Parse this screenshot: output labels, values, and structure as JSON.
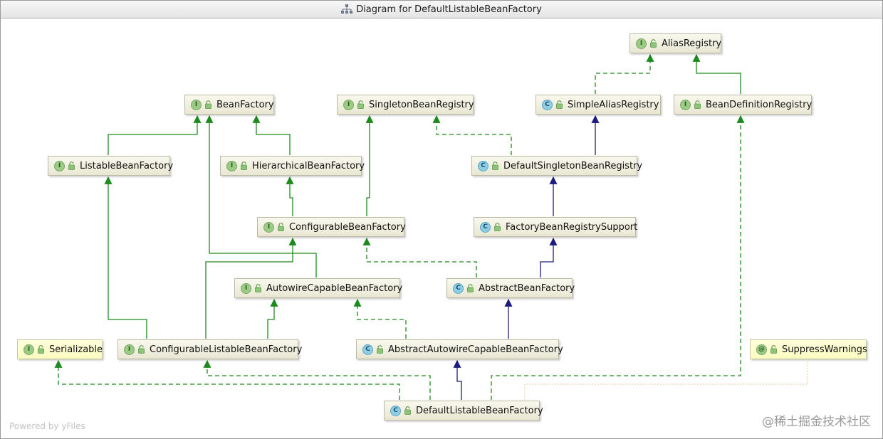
{
  "window": {
    "title": "Diagram for DefaultListableBeanFactory"
  },
  "nodes": {
    "alias_registry": {
      "label": "AliasRegistry",
      "kind": "interface"
    },
    "bean_factory": {
      "label": "BeanFactory",
      "kind": "interface"
    },
    "singleton_bean_registry": {
      "label": "SingletonBeanRegistry",
      "kind": "interface"
    },
    "simple_alias_registry": {
      "label": "SimpleAliasRegistry",
      "kind": "class"
    },
    "bean_definition_registry": {
      "label": "BeanDefinitionRegistry",
      "kind": "interface"
    },
    "listable_bean_factory": {
      "label": "ListableBeanFactory",
      "kind": "interface"
    },
    "hierarchical_bean_factory": {
      "label": "HierarchicalBeanFactory",
      "kind": "interface"
    },
    "default_singleton_bean_registry": {
      "label": "DefaultSingletonBeanRegistry",
      "kind": "class"
    },
    "configurable_bean_factory": {
      "label": "ConfigurableBeanFactory",
      "kind": "interface"
    },
    "factory_bean_registry_support": {
      "label": "FactoryBeanRegistrySupport",
      "kind": "class"
    },
    "autowire_capable_bean_factory": {
      "label": "AutowireCapableBeanFactory",
      "kind": "interface"
    },
    "abstract_bean_factory": {
      "label": "AbstractBeanFactory",
      "kind": "class"
    },
    "serializable": {
      "label": "Serializable",
      "kind": "interface"
    },
    "configurable_listable_bean_factory": {
      "label": "ConfigurableListableBeanFactory",
      "kind": "interface"
    },
    "abstract_autowire_capable_bean_factory": {
      "label": "AbstractAutowireCapableBeanFactory",
      "kind": "class"
    },
    "suppress_warnings": {
      "label": "SuppressWarnings",
      "kind": "annotation"
    },
    "default_listable_bean_factory": {
      "label": "DefaultListableBeanFactory",
      "kind": "class"
    }
  },
  "badges": {
    "interface": "I",
    "class": "C",
    "annotation": "@"
  },
  "colors": {
    "extends_interface": "#1d8a1d",
    "implements": "#1d8a1d",
    "extends_class": "#1a1a80",
    "annotation_link": "#f0c89a"
  },
  "footer": {
    "powered_by": "Powered by yFiles"
  },
  "watermark": "@稀土掘金技术社区"
}
